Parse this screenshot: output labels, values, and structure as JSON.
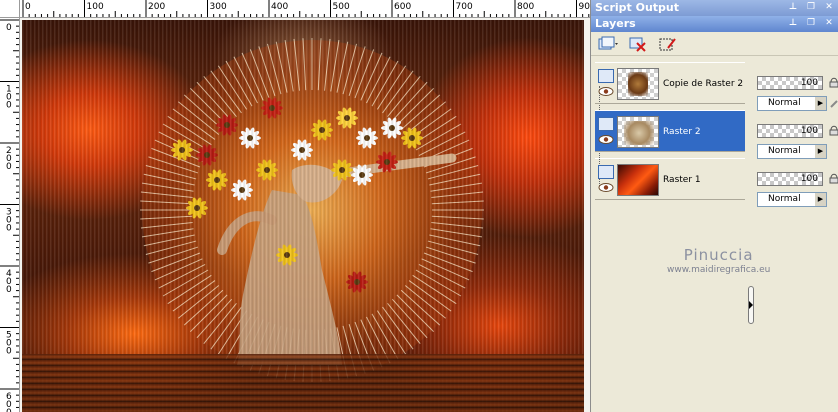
{
  "ruler": {
    "top_labels": [
      "0",
      "100",
      "200",
      "300",
      "400",
      "500",
      "600",
      "700",
      "800",
      "900"
    ],
    "left_labels": [
      "0",
      "100",
      "200",
      "300",
      "400",
      "500",
      "600"
    ]
  },
  "panels": {
    "script_output_title": "Script Output",
    "layers_title": "Layers"
  },
  "layers": [
    {
      "name": "Copie de Raster 2",
      "opacity": "100",
      "blend": "Normal",
      "selected": false
    },
    {
      "name": "Raster 2",
      "opacity": "100",
      "blend": "Normal",
      "selected": true
    },
    {
      "name": "Raster 1",
      "opacity": "100",
      "blend": "Normal",
      "selected": false
    }
  ],
  "watermark": {
    "name": "Pinuccia",
    "url": "www.maidiregrafica.eu"
  },
  "colors": {
    "selection": "#316ac5",
    "panel_bg": "#ece9d8",
    "title_bar": "#5f86cf"
  }
}
